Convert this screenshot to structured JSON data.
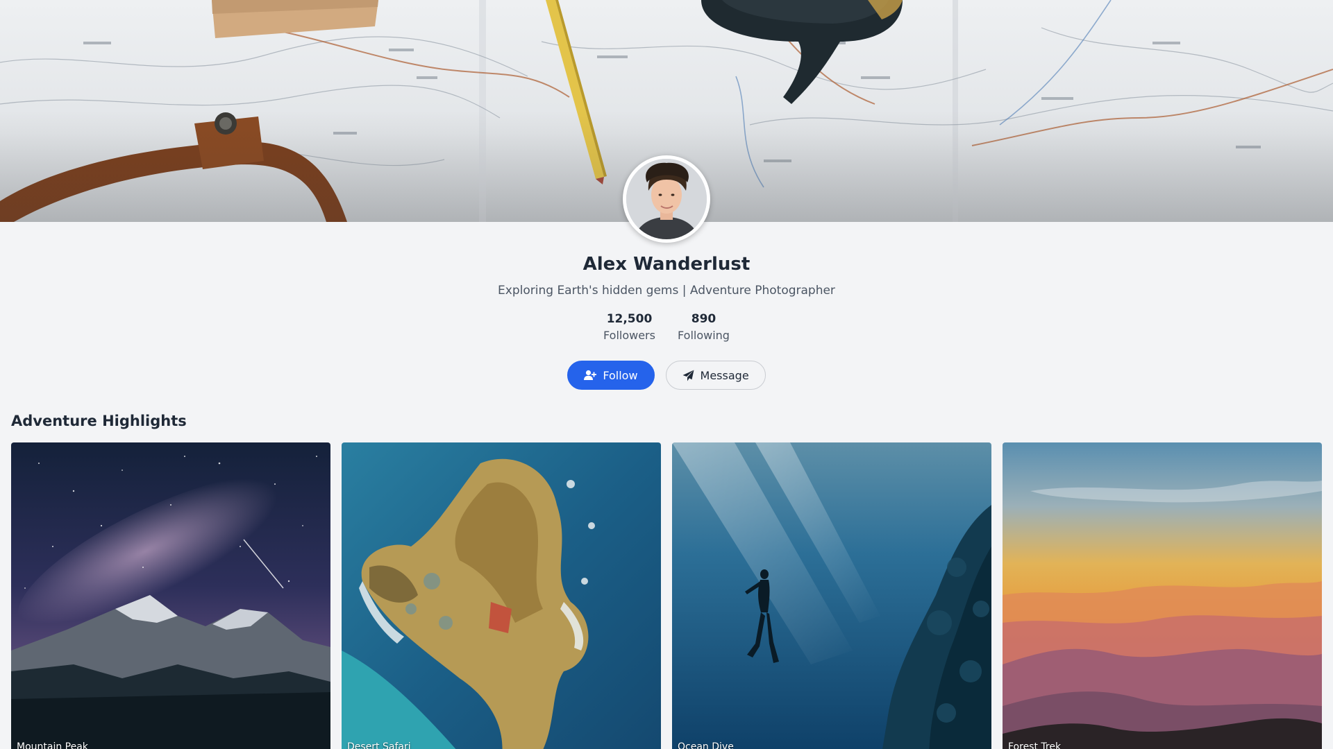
{
  "profile": {
    "name": "Alex Wanderlust",
    "bio": "Exploring Earth's hidden gems | Adventure Photographer",
    "stats": [
      {
        "value": "12,500",
        "label": "Followers"
      },
      {
        "value": "890",
        "label": "Following"
      }
    ]
  },
  "actions": {
    "follow_label": "Follow",
    "follow_icon": "user-plus-icon",
    "message_label": "Message",
    "message_icon": "paper-plane-icon"
  },
  "highlights": {
    "title": "Adventure Highlights",
    "items": [
      {
        "label": "Mountain Peak"
      },
      {
        "label": "Desert Safari"
      },
      {
        "label": "Ocean Dive"
      },
      {
        "label": "Forest Trek"
      }
    ]
  },
  "colors": {
    "accent": "#2563eb",
    "page_background": "#f3f4f6"
  }
}
